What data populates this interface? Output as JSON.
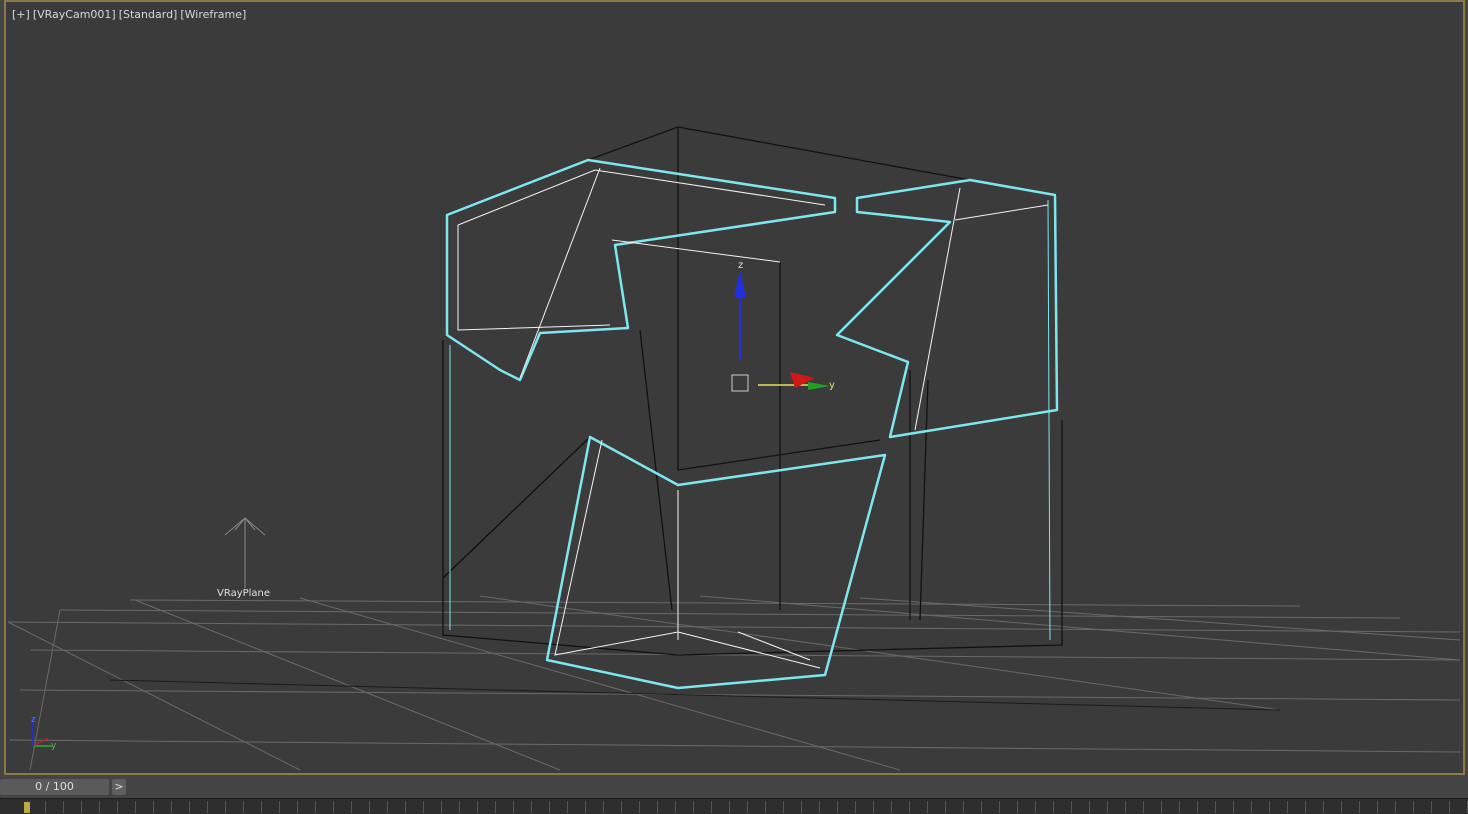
{
  "viewport": {
    "labels": [
      "[+]",
      "[VRayCam001]",
      "[Standard]",
      "[Wireframe]"
    ],
    "object_label": "VRayPlane",
    "gizmo_axes": {
      "z": "z",
      "y": "y"
    },
    "corner_axes": {
      "z": "z",
      "y": "y"
    },
    "colors": {
      "selected": "#7fe6f0",
      "wire": "#111111",
      "background": "#3b3b3b",
      "border": "#8a7a4a"
    }
  },
  "timeline": {
    "frame_display": "0 / 100",
    "next_label": ">",
    "current_frame": 0,
    "total_frames": 100
  }
}
